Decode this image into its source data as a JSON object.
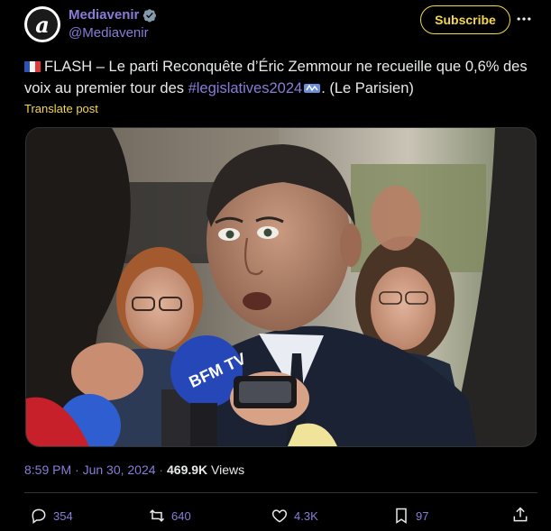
{
  "account": {
    "display_name": "Mediavenir",
    "handle": "@Mediavenir",
    "avatar_letter": "a",
    "verified_icon": "verified-badge-icon"
  },
  "header": {
    "subscribe_label": "Subscribe",
    "more_icon": "more-options-icon"
  },
  "post": {
    "flag_icon": "france-flag-icon",
    "text_part1": "FLASH – Le parti Reconquête d’Éric Zemmour ne recueille que 0,6% des voix au premier tour des ",
    "hashtag": "#legislatives2024",
    "hashtag_icon": "legislatives-emoji-icon",
    "text_part2": ". (Le Parisien)",
    "translate_label": "Translate post"
  },
  "image": {
    "microphone_label": "BFM TV"
  },
  "meta": {
    "time": "8:59 PM · Jun 30, 2024",
    "separator": " · ",
    "views_count": "469.9K",
    "views_label": " Views"
  },
  "actions": {
    "replies": "354",
    "reposts": "640",
    "likes": "4.3K",
    "bookmarks": "97"
  },
  "colors": {
    "accent": "#8b7bd8",
    "subscribe": "#f5d84a",
    "background": "#000000",
    "text": "#e7e9ea"
  }
}
